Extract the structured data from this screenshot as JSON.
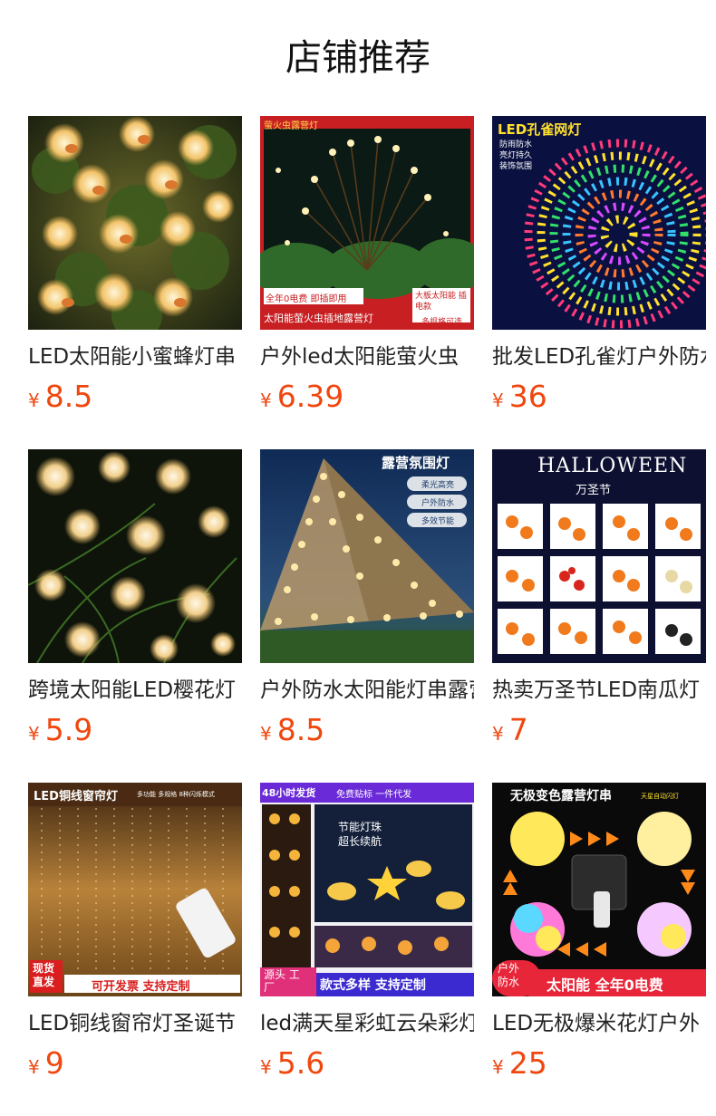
{
  "section": {
    "title": "店铺推荐"
  },
  "colors": {
    "price": "#f0470f",
    "title": "#111111",
    "name": "#222222"
  },
  "products": [
    {
      "name": "LED太阳能小蜜蜂灯串",
      "currency": "¥",
      "price": "8.5",
      "image": {
        "icon": "bee-string-lights-image",
        "overlay": []
      }
    },
    {
      "name": "户外led太阳能萤火虫",
      "currency": "¥",
      "price": "6.39",
      "image": {
        "icon": "firefly-garden-light-image",
        "overlay": [
          "萤火虫露营灯",
          "全年0电费 即插即用",
          "大板太阳能 插电款",
          "太阳能萤火虫插地露营灯",
          "多规格可选"
        ]
      }
    },
    {
      "name": "批发LED孔雀灯户外防水",
      "currency": "¥",
      "price": "36",
      "image": {
        "icon": "peacock-net-light-image",
        "overlay": [
          "LED孔雀网灯",
          "防雨防水",
          "亮灯持久",
          "装饰氛围"
        ]
      }
    },
    {
      "name": "跨境太阳能LED樱花灯",
      "currency": "¥",
      "price": "5.9",
      "image": {
        "icon": "cherry-blossom-lights-image",
        "overlay": []
      }
    },
    {
      "name": "户外防水太阳能灯串露营",
      "currency": "¥",
      "price": "8.5",
      "image": {
        "icon": "camping-tent-lights-image",
        "overlay": [
          "露营氛围灯",
          "柔光高亮",
          "户外防水",
          "多效节能"
        ]
      }
    },
    {
      "name": "热卖万圣节LED南瓜灯",
      "currency": "¥",
      "price": "7",
      "image": {
        "icon": "halloween-pumpkin-lights-image",
        "overlay": [
          "HALLOWEEN",
          "万圣节"
        ]
      }
    },
    {
      "name": "LED铜线窗帘灯圣诞节",
      "currency": "¥",
      "price": "9",
      "image": {
        "icon": "curtain-lights-image",
        "overlay": [
          "LED铜线窗帘灯",
          "多功能 多规格 8种闪烁模式",
          "现货 直发",
          "可开发票 支持定制"
        ]
      }
    },
    {
      "name": "led满天星彩虹云朵彩灯",
      "currency": "¥",
      "price": "5.6",
      "image": {
        "icon": "cloud-star-lights-image",
        "overlay": [
          "48小时发货",
          "免费贴标 一件代发",
          "节能灯珠",
          "超长续航",
          "源头 工厂",
          "款式多样 支持定制"
        ]
      }
    },
    {
      "name": "LED无极爆米花灯户外",
      "currency": "¥",
      "price": "25",
      "image": {
        "icon": "popcorn-lights-image",
        "overlay": [
          "无极变色露营灯串",
          "天星自动闪灯",
          "户外 防水",
          "太阳能 全年0电费"
        ]
      }
    }
  ]
}
